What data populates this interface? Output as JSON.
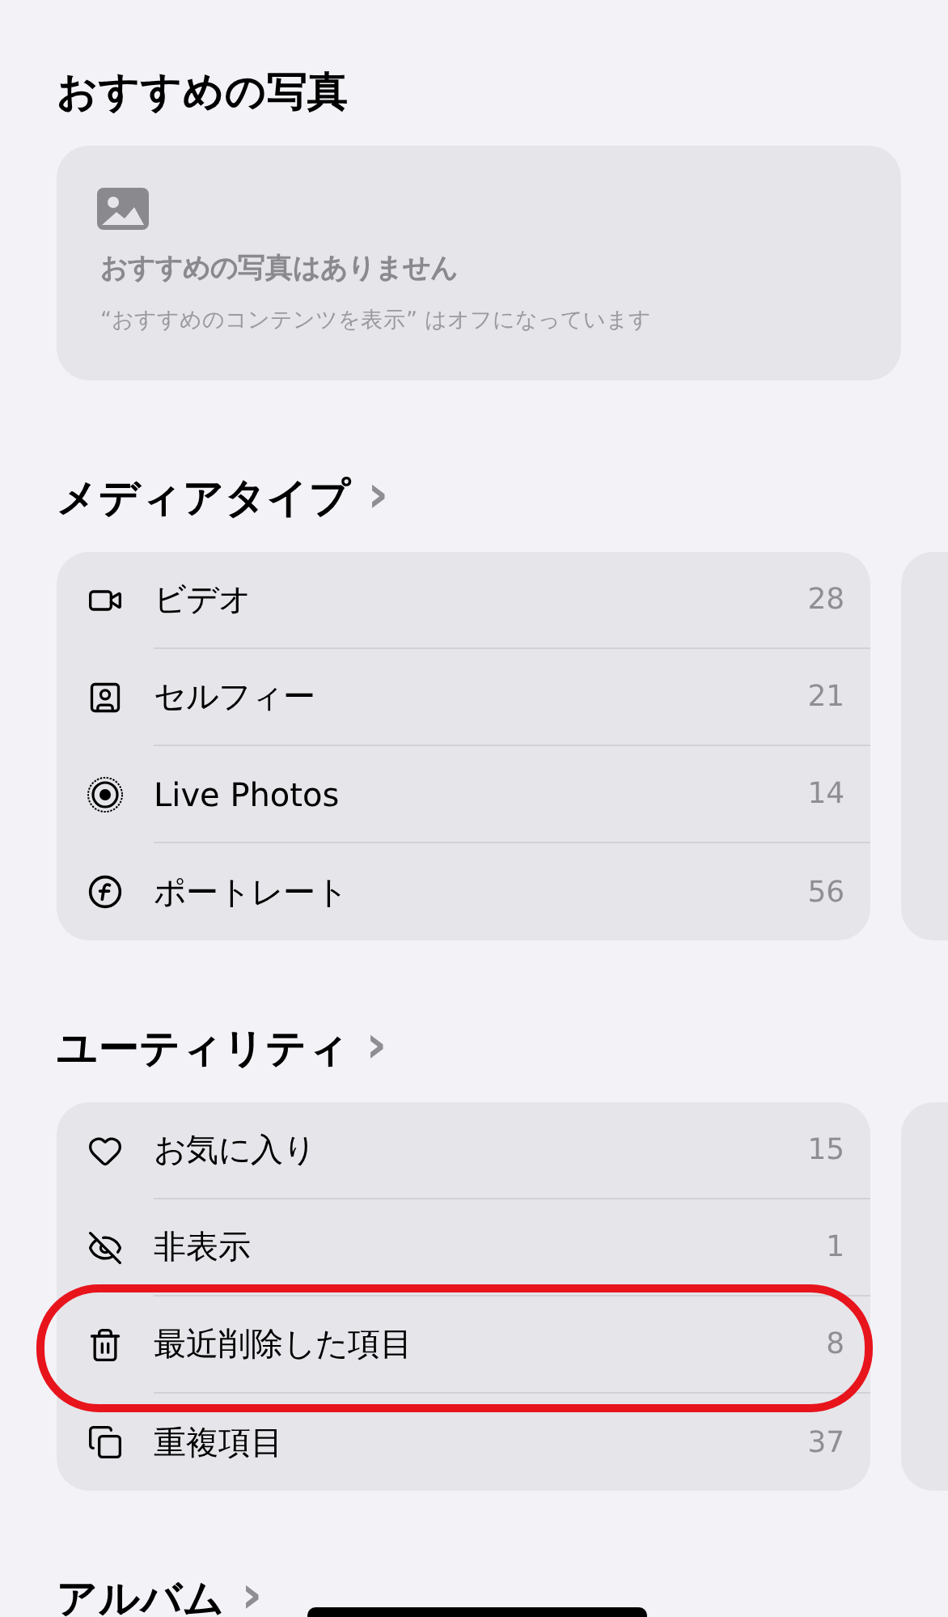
{
  "featured": {
    "title": "おすすめの写真",
    "empty_title": "おすすめの写真はありません",
    "empty_note": "“おすすめのコンテンツを表示” はオフになっています"
  },
  "sections": [
    {
      "title": "メディアタイプ",
      "chevron": "›",
      "items": [
        {
          "kind": "video",
          "label": "ビデオ",
          "count": "28",
          "circled": false
        },
        {
          "kind": "selfie",
          "label": "セルフィー",
          "count": "21",
          "circled": false
        },
        {
          "kind": "live",
          "label": "Live Photos",
          "count": "14",
          "circled": false
        },
        {
          "kind": "portrait",
          "label": "ポートレート",
          "count": "56",
          "circled": false
        }
      ]
    },
    {
      "title": "ユーティリティ",
      "chevron": "›",
      "items": [
        {
          "kind": "favorite",
          "label": "お気に入り",
          "count": "15",
          "circled": false
        },
        {
          "kind": "hidden",
          "label": "非表示",
          "count": "1",
          "circled": false
        },
        {
          "kind": "trash",
          "label": "最近削除した項目",
          "count": "8",
          "circled": true
        },
        {
          "kind": "duplicate",
          "label": "重複項目",
          "count": "37",
          "circled": false
        }
      ]
    },
    {
      "title": "アルバム",
      "chevron": "›"
    }
  ]
}
